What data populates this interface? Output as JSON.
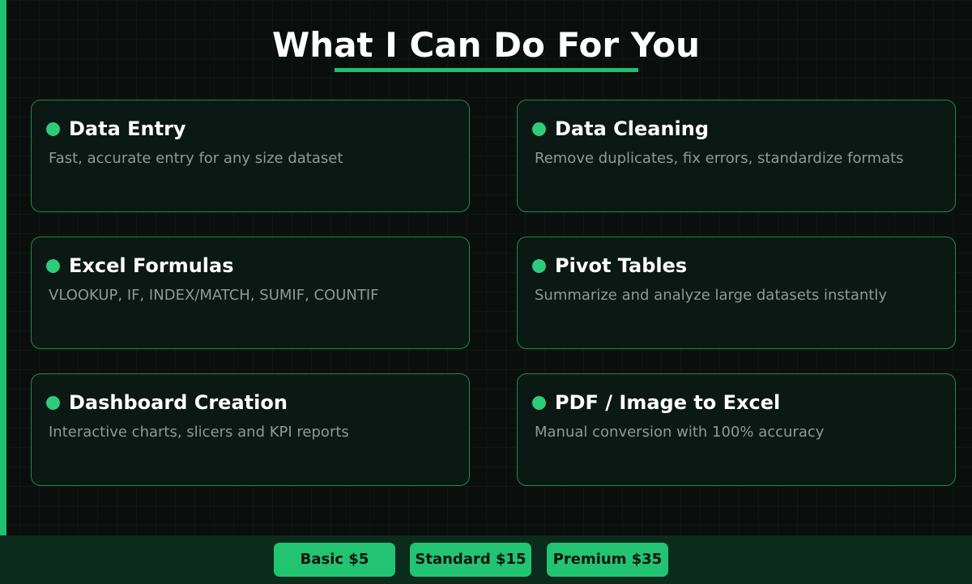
{
  "page": {
    "title": "What I Can Do For You"
  },
  "colors": {
    "accent": "#1fc06e",
    "background": "#0a0e0d",
    "card_background": "#0c1813",
    "card_border": "#1f8a4f",
    "footer_background": "#0b2c1c",
    "title_text": "#ffffff",
    "description_text": "#8e9a94"
  },
  "services": [
    {
      "icon": "bullet-dot-icon",
      "title": "Data Entry",
      "description": "Fast, accurate entry for any size dataset"
    },
    {
      "icon": "bullet-dot-icon",
      "title": "Data Cleaning",
      "description": "Remove duplicates, fix errors, standardize formats"
    },
    {
      "icon": "bullet-dot-icon",
      "title": "Excel Formulas",
      "description": "VLOOKUP, IF, INDEX/MATCH, SUMIF, COUNTIF"
    },
    {
      "icon": "bullet-dot-icon",
      "title": "Pivot Tables",
      "description": "Summarize and analyze large datasets instantly"
    },
    {
      "icon": "bullet-dot-icon",
      "title": "Dashboard Creation",
      "description": "Interactive charts, slicers and KPI reports"
    },
    {
      "icon": "bullet-dot-icon",
      "title": "PDF / Image to Excel",
      "description": "Manual conversion with 100% accuracy"
    }
  ],
  "pricing": [
    {
      "label": "Basic $5"
    },
    {
      "label": "Standard $15"
    },
    {
      "label": "Premium $35"
    }
  ]
}
